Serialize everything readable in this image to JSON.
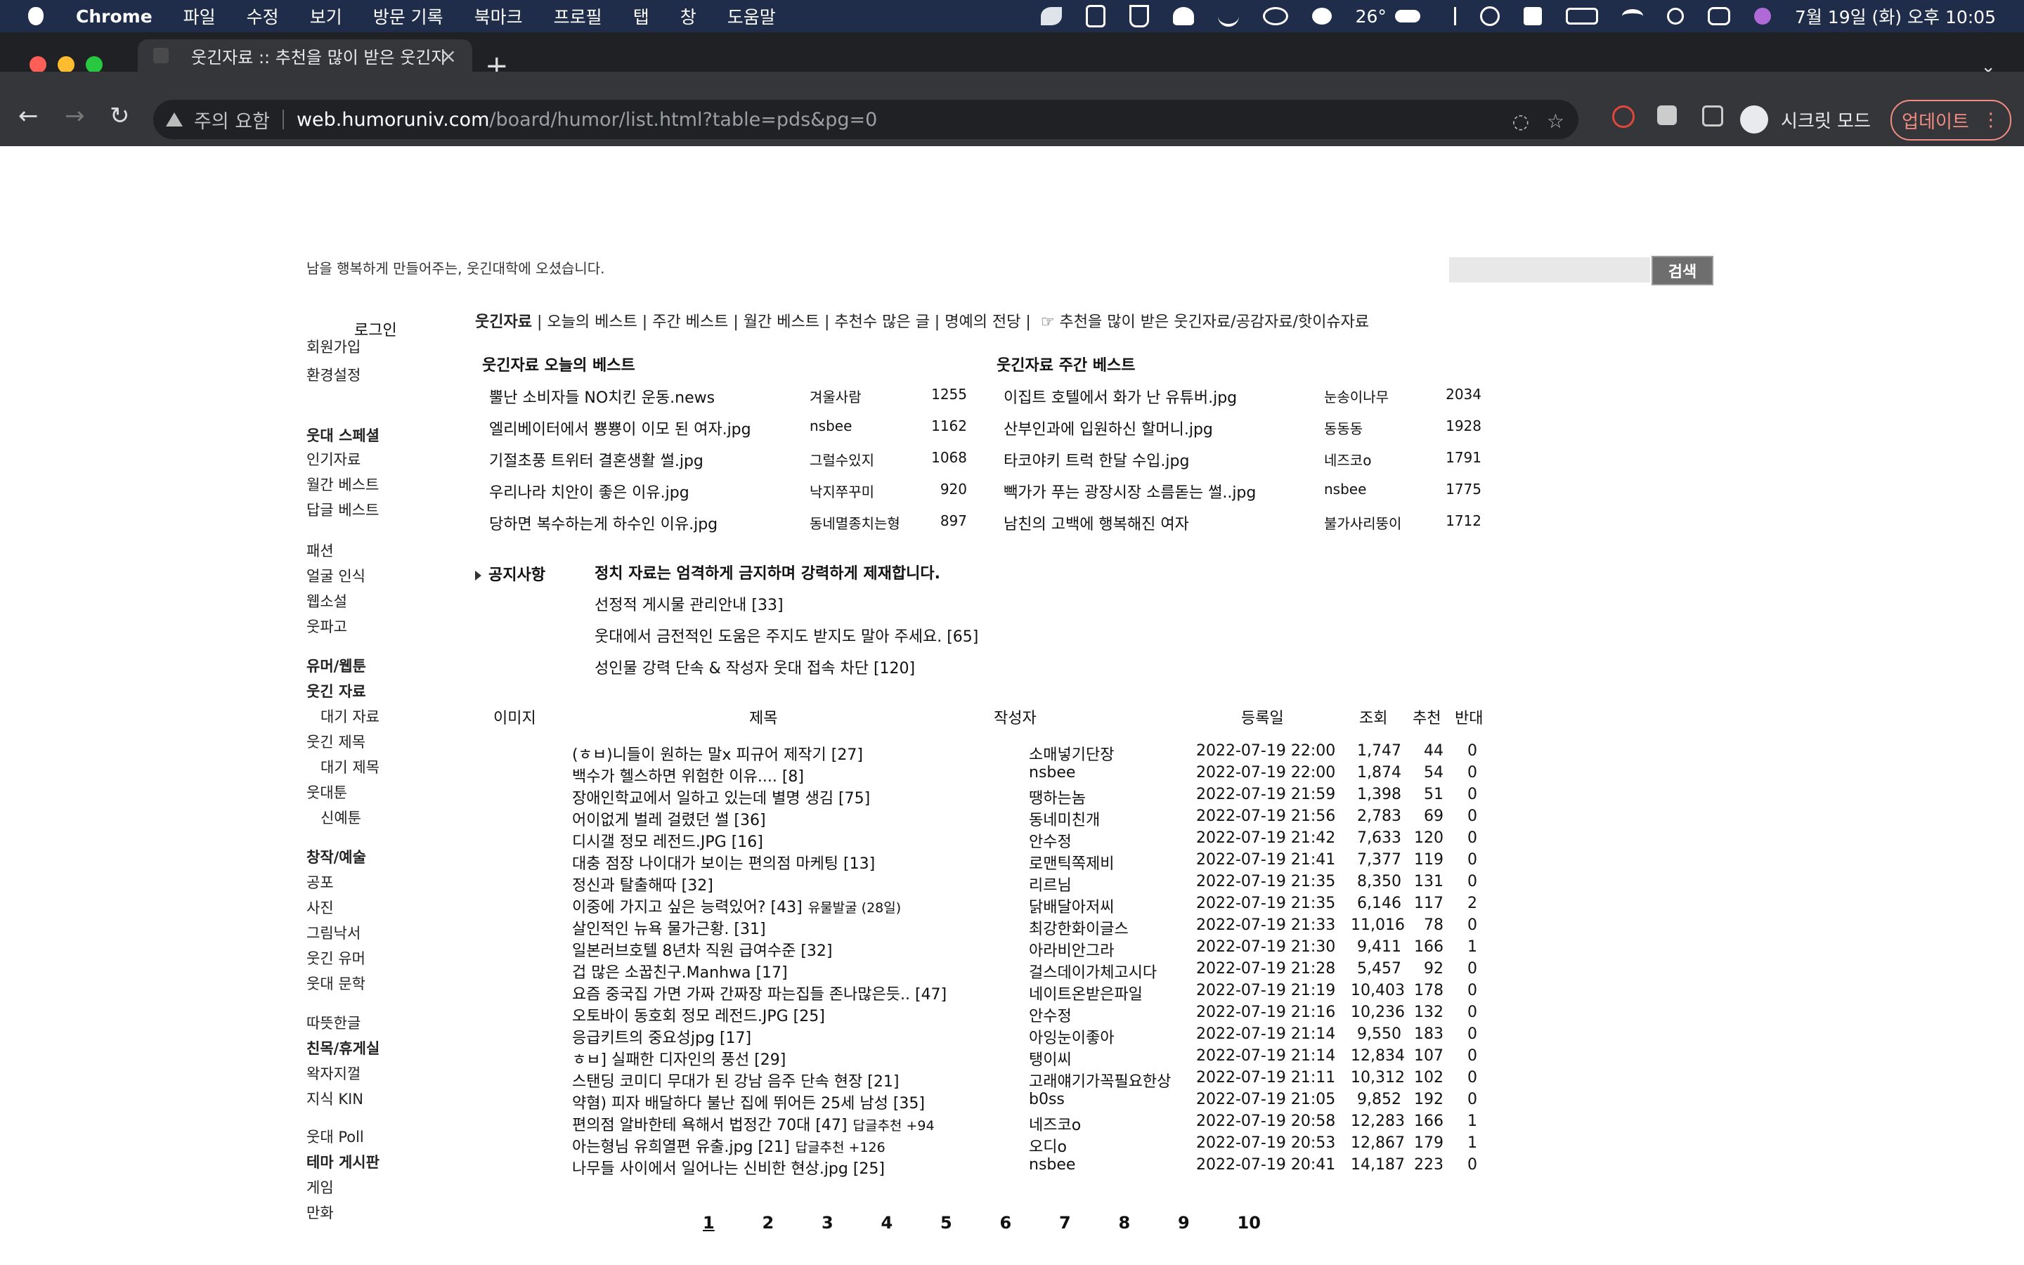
{
  "menubar": {
    "app": "Chrome",
    "items": [
      "파일",
      "수정",
      "보기",
      "방문 기록",
      "북마크",
      "프로필",
      "탭",
      "창",
      "도움말"
    ],
    "temp": "26°",
    "datetime": "7월 19일 (화) 오후 10:05"
  },
  "browser": {
    "tab_title": "웃긴자료 :: 추천을 많이 받은 웃긴자료",
    "security_label": "주의 요함",
    "url_host": "web.humoruniv.com",
    "url_path": "/board/humor/list.html?table=pds&pg=0",
    "incognito_label": "시크릿 모드",
    "update_label": "업데이트"
  },
  "header": {
    "welcome": "남을 행복하게 만들어주는, 웃긴대학에 오셨습니다.",
    "search_button": "검색"
  },
  "sidebar": {
    "login": "로그인",
    "items": [
      {
        "label": "회원가입",
        "type": "item"
      },
      {
        "label": "환경설정",
        "type": "item"
      },
      {
        "label": "웃대 스페셜",
        "type": "head"
      },
      {
        "label": "인기자료",
        "type": "item"
      },
      {
        "label": "월간 베스트",
        "type": "item"
      },
      {
        "label": "답글 베스트",
        "type": "item"
      },
      {
        "label": "패션",
        "type": "item"
      },
      {
        "label": "얼굴 인식",
        "type": "item"
      },
      {
        "label": "웹소설",
        "type": "item"
      },
      {
        "label": "웃파고",
        "type": "item"
      },
      {
        "label": "유머/웹툰",
        "type": "head"
      },
      {
        "label": "웃긴 자료",
        "type": "head"
      },
      {
        "label": "대기 자료",
        "type": "sub"
      },
      {
        "label": "웃긴 제목",
        "type": "item"
      },
      {
        "label": "대기 제목",
        "type": "sub"
      },
      {
        "label": "웃대툰",
        "type": "item"
      },
      {
        "label": "신예툰",
        "type": "sub"
      },
      {
        "label": "창작/예술",
        "type": "head"
      },
      {
        "label": "공포",
        "type": "item"
      },
      {
        "label": "사진",
        "type": "item"
      },
      {
        "label": "그림낙서",
        "type": "item"
      },
      {
        "label": "웃긴 유머",
        "type": "item"
      },
      {
        "label": "웃대 문학",
        "type": "item"
      },
      {
        "label": "따뜻한글",
        "type": "item"
      },
      {
        "label": "친목/휴게실",
        "type": "head"
      },
      {
        "label": "왁자지껄",
        "type": "item"
      },
      {
        "label": "지식 KIN",
        "type": "item"
      },
      {
        "label": "웃대 Poll",
        "type": "item"
      },
      {
        "label": "테마 게시판",
        "type": "head"
      },
      {
        "label": "게임",
        "type": "item"
      },
      {
        "label": "만화",
        "type": "item"
      }
    ]
  },
  "topnav": {
    "current": "웃긴자료",
    "links": "| 오늘의 베스트 | 주간 베스트 | 월간 베스트 | 추천수 많은 글 | 명예의 전당 |",
    "note": "☞ 추천을 많이 받은 웃긴자료/공감자료/핫이슈자료"
  },
  "best_today": {
    "title": "웃긴자료 오늘의 베스트",
    "rows": [
      {
        "title": "뿔난 소비자들 NO치킨 운동.news",
        "author": "겨울사람",
        "count": "1255"
      },
      {
        "title": "엘리베이터에서 뿅뿅이 이모 된 여자.jpg",
        "author": "nsbee",
        "count": "1162"
      },
      {
        "title": "기절초풍 트위터 결혼생활 썰.jpg",
        "author": "그럴수있지",
        "count": "1068"
      },
      {
        "title": "우리나라 치안이 좋은 이유.jpg",
        "author": "낙지쭈꾸미",
        "count": "920"
      },
      {
        "title": "당하면 복수하는게 하수인 이유.jpg",
        "author": "동네멸종치는형",
        "count": "897"
      }
    ]
  },
  "best_week": {
    "title": "웃긴자료 주간 베스트",
    "rows": [
      {
        "title": "이집트 호텔에서 화가 난 유튜버.jpg",
        "author": "눈송이나무",
        "count": "2034"
      },
      {
        "title": "산부인과에 입원하신 할머니.jpg",
        "author": "동동동",
        "count": "1928"
      },
      {
        "title": "타코야키 트럭 한달 수입.jpg",
        "author": "네즈코o",
        "count": "1791"
      },
      {
        "title": "빽가가 푸는 광장시장 소름돋는 썰..jpg",
        "author": "nsbee",
        "count": "1775"
      },
      {
        "title": "남친의 고백에 행복해진 여자",
        "author": "불가사리뚱이",
        "count": "1712"
      }
    ]
  },
  "notices": {
    "label": "공지사항",
    "items": [
      "정치 자료는 엄격하게 금지하며 강력하게 제재합니다.",
      "선정적 게시물 관리안내 [33]",
      "웃대에서 금전적인 도움은 주지도 받지도 말아 주세요. [65]",
      "성인물 강력 단속 & 작성자 웃대 접속 차단 [120]"
    ]
  },
  "table": {
    "headers": {
      "image": "이미지",
      "title": "제목",
      "author": "작성자",
      "date": "등록일",
      "views": "조회",
      "rec": "추천",
      "opp": "반대"
    },
    "rows": [
      {
        "title": "(ㅎㅂ)니들이 원하는 말x 피규어 제작기 [27]",
        "extra": "",
        "author": "소매넣기단장",
        "date": "2022-07-19 22:00",
        "views": "1,747",
        "rec": "44",
        "opp": "0"
      },
      {
        "title": "백수가 헬스하면 위험한 이유.... [8]",
        "extra": "",
        "author": "nsbee",
        "date": "2022-07-19 22:00",
        "views": "1,874",
        "rec": "54",
        "opp": "0"
      },
      {
        "title": "장애인학교에서 일하고 있는데 별명 생김 [75]",
        "extra": "",
        "author": "땡하는놈",
        "date": "2022-07-19 21:59",
        "views": "1,398",
        "rec": "51",
        "opp": "0"
      },
      {
        "title": "어이없게 벌레 걸렸던 썰 [36]",
        "extra": "",
        "author": "동네미친개",
        "date": "2022-07-19 21:56",
        "views": "2,783",
        "rec": "69",
        "opp": "0"
      },
      {
        "title": "디시갤 정모 레전드.JPG [16]",
        "extra": "",
        "author": "안수정",
        "date": "2022-07-19 21:42",
        "views": "7,633",
        "rec": "120",
        "opp": "0"
      },
      {
        "title": "대충 점장 나이대가 보이는 편의점 마케팅 [13]",
        "extra": "",
        "author": "로맨틱쪽제비",
        "date": "2022-07-19 21:41",
        "views": "7,377",
        "rec": "119",
        "opp": "0"
      },
      {
        "title": "정신과 탈출해따 [32]",
        "extra": "",
        "author": "리르님",
        "date": "2022-07-19 21:35",
        "views": "8,350",
        "rec": "131",
        "opp": "0"
      },
      {
        "title": "이중에 가지고 싶은 능력있어? [43]",
        "extra": "유물발굴 (28일)",
        "author": "닭배달아저씨",
        "date": "2022-07-19 21:35",
        "views": "6,146",
        "rec": "117",
        "opp": "2"
      },
      {
        "title": "살인적인 뉴욕 물가근황. [31]",
        "extra": "",
        "author": "최강한화이글스",
        "date": "2022-07-19 21:33",
        "views": "11,016",
        "rec": "78",
        "opp": "0"
      },
      {
        "title": "일본러브호텔 8년차 직원 급여수준 [32]",
        "extra": "",
        "author": "아라비안그라",
        "date": "2022-07-19 21:30",
        "views": "9,411",
        "rec": "166",
        "opp": "1"
      },
      {
        "title": "겁 많은 소꿉친구.Manhwa [17]",
        "extra": "",
        "author": "걸스데이가체고시다",
        "date": "2022-07-19 21:28",
        "views": "5,457",
        "rec": "92",
        "opp": "0"
      },
      {
        "title": "요즘 중국집 가면 가짜 간짜장 파는집들 존나많은듯.. [47]",
        "extra": "",
        "author": "네이트온받은파일",
        "date": "2022-07-19 21:19",
        "views": "10,403",
        "rec": "178",
        "opp": "0"
      },
      {
        "title": "오토바이 동호회 정모 레전드.JPG [25]",
        "extra": "",
        "author": "안수정",
        "date": "2022-07-19 21:16",
        "views": "10,236",
        "rec": "132",
        "opp": "0"
      },
      {
        "title": "응급키트의 중요성jpg [17]",
        "extra": "",
        "author": "아잉눈이좋아",
        "date": "2022-07-19 21:14",
        "views": "9,550",
        "rec": "183",
        "opp": "0"
      },
      {
        "title": "ㅎㅂ] 실패한 디자인의 풍선 [29]",
        "extra": "",
        "author": "탱이씨",
        "date": "2022-07-19 21:14",
        "views": "12,834",
        "rec": "107",
        "opp": "0"
      },
      {
        "title": "스탠딩 코미디 무대가 된 강남 음주 단속 현장 [21]",
        "extra": "",
        "author": "고래얘기가꼭필요한상",
        "date": "2022-07-19 21:11",
        "views": "10,312",
        "rec": "102",
        "opp": "0"
      },
      {
        "title": "약혐) 피자 배달하다 불난 집에 뛰어든 25세 남성 [35]",
        "extra": "",
        "author": "b0ss",
        "date": "2022-07-19 21:05",
        "views": "9,852",
        "rec": "192",
        "opp": "0"
      },
      {
        "title": "편의점 알바한테 욕해서 법정간 70대 [47]",
        "extra": "답글추천 +94",
        "author": "네즈코o",
        "date": "2022-07-19 20:58",
        "views": "12,283",
        "rec": "166",
        "opp": "1"
      },
      {
        "title": "아는형님 유희열편 유출.jpg [21]",
        "extra": "답글추천 +126",
        "author": "오디o",
        "date": "2022-07-19 20:53",
        "views": "12,867",
        "rec": "179",
        "opp": "1"
      },
      {
        "title": "나무들 사이에서 일어나는 신비한 현상.jpg [25]",
        "extra": "",
        "author": "nsbee",
        "date": "2022-07-19 20:41",
        "views": "14,187",
        "rec": "223",
        "opp": "0"
      }
    ]
  },
  "pagination": {
    "current": "1",
    "pages": [
      "1",
      "2",
      "3",
      "4",
      "5",
      "6",
      "7",
      "8",
      "9",
      "10"
    ]
  },
  "colors": {
    "menubar": "#1f2d4a",
    "chrome_dark": "#202124",
    "toolbar": "#35363a",
    "update": "#f28b82"
  }
}
